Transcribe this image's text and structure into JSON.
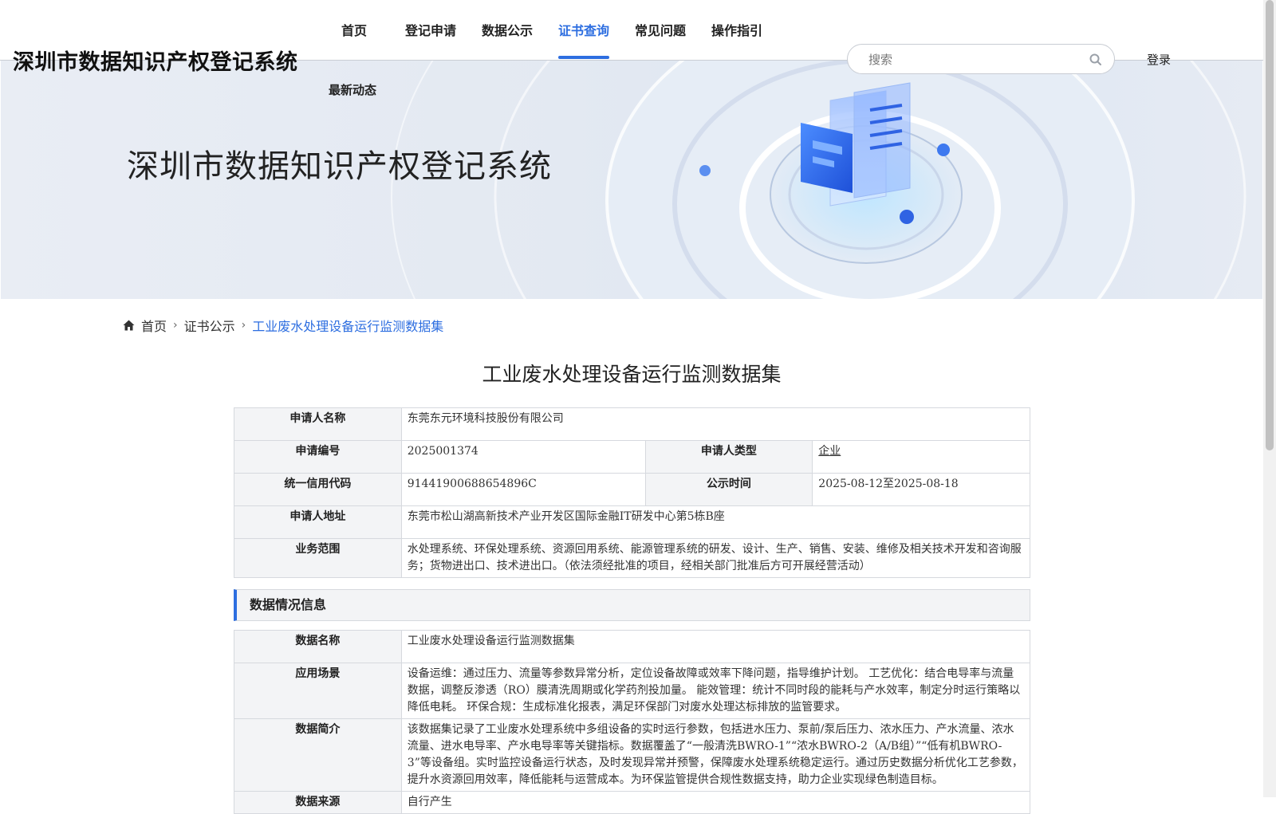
{
  "header": {
    "site_title": "深圳市数据知识产权登记系统",
    "nav": [
      "首页",
      "登记申请",
      "数据公示",
      "证书查询",
      "常见问题",
      "操作指引"
    ],
    "nav_second_row": "最新动态",
    "active_nav": "证书查询",
    "search_placeholder": "搜索",
    "login_label": "登录"
  },
  "banner": {
    "title": "深圳市数据知识产权登记系统"
  },
  "breadcrumb": {
    "home": "首页",
    "level2": "证书公示",
    "current": "工业废水处理设备运行监测数据集"
  },
  "page_title": "工业废水处理设备运行监测数据集",
  "applicant": {
    "name_label": "申请人名称",
    "name": "东莞东元环境科技股份有限公司",
    "number_label": "申请编号",
    "number": "2025001374",
    "type_label": "申请人类型",
    "type": "企业",
    "credit_label": "统一信用代码",
    "credit": "91441900688654896C",
    "publicity_label": "公示时间",
    "publicity": "2025-08-12至2025-08-18",
    "address_label": "申请人地址",
    "address": "东莞市松山湖高新技术产业开发区国际金融IT研发中心第5栋B座",
    "scope_label": "业务范围",
    "scope": "水处理系统、环保处理系统、资源回用系统、能源管理系统的研发、设计、生产、销售、安装、维修及相关技术开发和咨询服务；货物进出口、技术进出口。（依法须经批准的项目，经相关部门批准后方可开展经营活动）"
  },
  "data_section": {
    "heading": "数据情况信息",
    "name_label": "数据名称",
    "name": "工业废水处理设备运行监测数据集",
    "scene_label": "应用场景",
    "scene": "设备运维：通过压力、流量等参数异常分析，定位设备故障或效率下降问题，指导维护计划。 工艺优化：结合电导率与流量数据，调整反渗透（RO）膜清洗周期或化学药剂投加量。 能效管理：统计不同时段的能耗与产水效率，制定分时运行策略以降低电耗。 环保合规：生成标准化报表，满足环保部门对废水处理达标排放的监管要求。",
    "intro_label": "数据简介",
    "intro": "该数据集记录了工业废水处理系统中多组设备的实时运行参数，包括进水压力、泵前/泵后压力、浓水压力、产水流量、浓水流量、进水电导率、产水电导率等关键指标。数据覆盖了“一般清洗BWRO-1”“浓水BWRO-2（A/B组）”“低有机BWRO-3”等设备组。实时监控设备运行状态，及时发现异常并预警，保障废水处理系统稳定运行。通过历史数据分析优化工艺参数，提升水资源回用效率，降低能耗与运营成本。为环保监管提供合规性数据支持，助力企业实现绿色制造目标。",
    "source_label": "数据来源",
    "source": "自行产生"
  },
  "colors": {
    "accent": "#2d6ee0"
  }
}
